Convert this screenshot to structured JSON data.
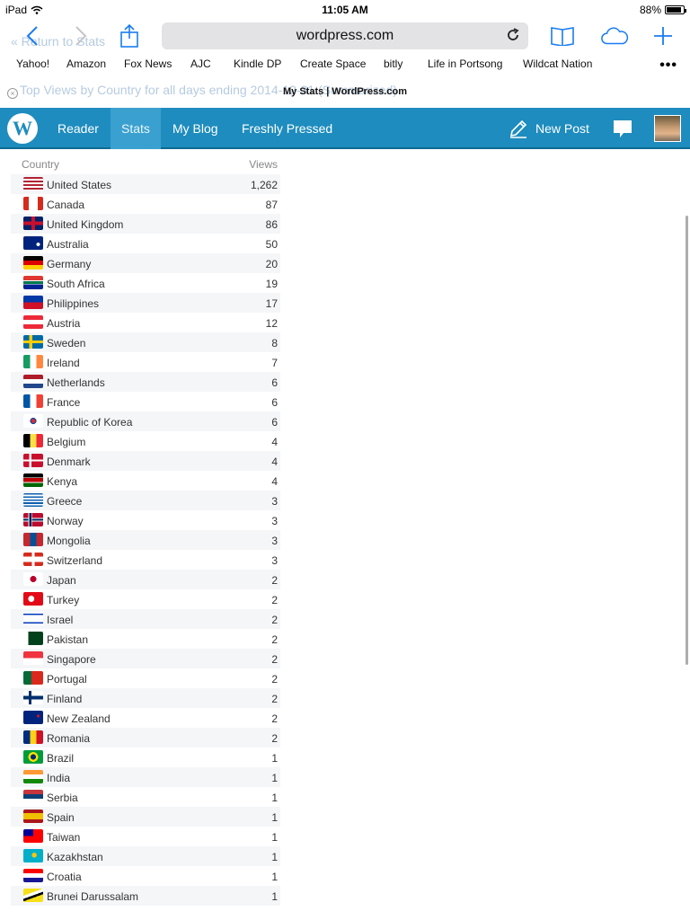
{
  "status": {
    "device": "iPad",
    "time": "11:05 AM",
    "battery": "88%",
    "battery_level": 0.88
  },
  "browser": {
    "url": "wordpress.com",
    "bookmarks": [
      "Yahoo!",
      "Amazon",
      "Fox News",
      "AJC",
      "Kindle DP",
      "Create Space",
      "bitly",
      "Life in Portsong",
      "Wildcat Nation"
    ],
    "tab_title": "My Stats | WordPress.com",
    "ghost_text_1": "« Return to Stats",
    "ghost_text_2": "Top Views by Country for all days ending 2014-12-31 (Summarized)"
  },
  "wp": {
    "logo_letter": "W",
    "nav": [
      "Reader",
      "Stats",
      "My Blog",
      "Freshly Pressed"
    ],
    "active_nav": "Stats",
    "new_post": "New Post",
    "colors": {
      "bar": "#1e8cbe",
      "active": "#3aa0d0"
    }
  },
  "table": {
    "col_country": "Country",
    "col_views": "Views",
    "rows": [
      {
        "country": "United States",
        "views": "1,262",
        "flag": "us-flag-icon"
      },
      {
        "country": "Canada",
        "views": "87",
        "flag": "ca-flag-icon"
      },
      {
        "country": "United Kingdom",
        "views": "86",
        "flag": "gb-flag-icon"
      },
      {
        "country": "Australia",
        "views": "50",
        "flag": "au-flag-icon"
      },
      {
        "country": "Germany",
        "views": "20",
        "flag": "de-flag-icon"
      },
      {
        "country": "South Africa",
        "views": "19",
        "flag": "za-flag-icon"
      },
      {
        "country": "Philippines",
        "views": "17",
        "flag": "ph-flag-icon"
      },
      {
        "country": "Austria",
        "views": "12",
        "flag": "at-flag-icon"
      },
      {
        "country": "Sweden",
        "views": "8",
        "flag": "se-flag-icon"
      },
      {
        "country": "Ireland",
        "views": "7",
        "flag": "ie-flag-icon"
      },
      {
        "country": "Netherlands",
        "views": "6",
        "flag": "nl-flag-icon"
      },
      {
        "country": "France",
        "views": "6",
        "flag": "fr-flag-icon"
      },
      {
        "country": "Republic of Korea",
        "views": "6",
        "flag": "kr-flag-icon"
      },
      {
        "country": "Belgium",
        "views": "4",
        "flag": "be-flag-icon"
      },
      {
        "country": "Denmark",
        "views": "4",
        "flag": "dk-flag-icon"
      },
      {
        "country": "Kenya",
        "views": "4",
        "flag": "ke-flag-icon"
      },
      {
        "country": "Greece",
        "views": "3",
        "flag": "gr-flag-icon"
      },
      {
        "country": "Norway",
        "views": "3",
        "flag": "no-flag-icon"
      },
      {
        "country": "Mongolia",
        "views": "3",
        "flag": "mn-flag-icon"
      },
      {
        "country": "Switzerland",
        "views": "3",
        "flag": "ch-flag-icon"
      },
      {
        "country": "Japan",
        "views": "2",
        "flag": "jp-flag-icon"
      },
      {
        "country": "Turkey",
        "views": "2",
        "flag": "tr-flag-icon"
      },
      {
        "country": "Israel",
        "views": "2",
        "flag": "il-flag-icon"
      },
      {
        "country": "Pakistan",
        "views": "2",
        "flag": "pk-flag-icon"
      },
      {
        "country": "Singapore",
        "views": "2",
        "flag": "sg-flag-icon"
      },
      {
        "country": "Portugal",
        "views": "2",
        "flag": "pt-flag-icon"
      },
      {
        "country": "Finland",
        "views": "2",
        "flag": "fi-flag-icon"
      },
      {
        "country": "New Zealand",
        "views": "2",
        "flag": "nz-flag-icon"
      },
      {
        "country": "Romania",
        "views": "2",
        "flag": "ro-flag-icon"
      },
      {
        "country": "Brazil",
        "views": "1",
        "flag": "br-flag-icon"
      },
      {
        "country": "India",
        "views": "1",
        "flag": "in-flag-icon"
      },
      {
        "country": "Serbia",
        "views": "1",
        "flag": "rs-flag-icon"
      },
      {
        "country": "Spain",
        "views": "1",
        "flag": "es-flag-icon"
      },
      {
        "country": "Taiwan",
        "views": "1",
        "flag": "tw-flag-icon"
      },
      {
        "country": "Kazakhstan",
        "views": "1",
        "flag": "kz-flag-icon"
      },
      {
        "country": "Croatia",
        "views": "1",
        "flag": "hr-flag-icon"
      },
      {
        "country": "Brunei Darussalam",
        "views": "1",
        "flag": "bn-flag-icon"
      }
    ]
  }
}
